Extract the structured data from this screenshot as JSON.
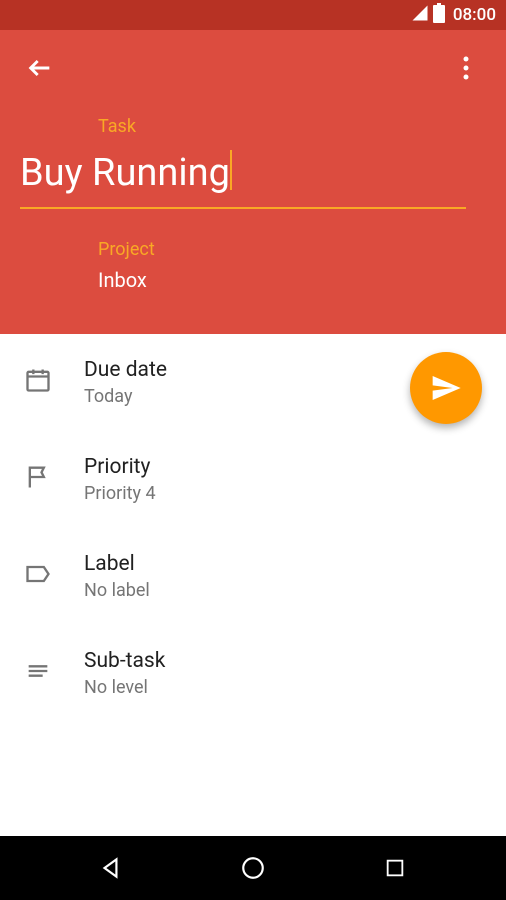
{
  "status": {
    "time": "08:00"
  },
  "task": {
    "field_label": "Task",
    "value": "Buy Running"
  },
  "project": {
    "field_label": "Project",
    "value": "Inbox"
  },
  "rows": {
    "due_date": {
      "title": "Due date",
      "value": "Today"
    },
    "priority": {
      "title": "Priority",
      "value": "Priority 4"
    },
    "label": {
      "title": "Label",
      "value": "No label"
    },
    "subtask": {
      "title": "Sub-task",
      "value": "No level"
    }
  }
}
